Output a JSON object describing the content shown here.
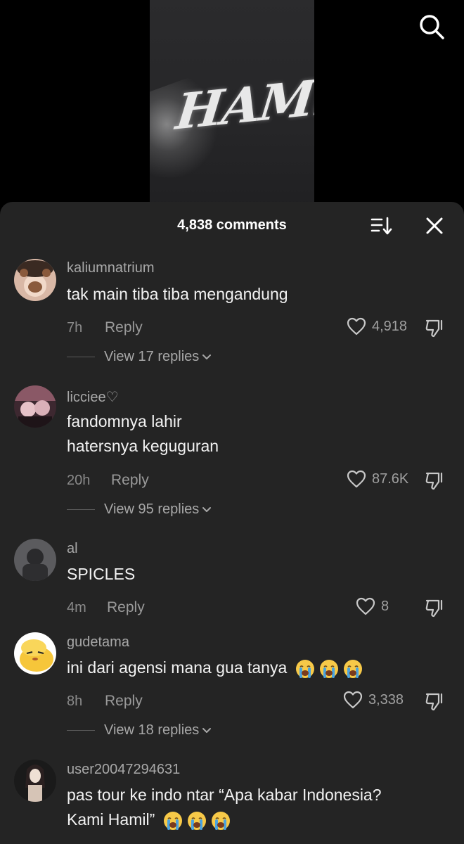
{
  "video": {
    "title_art": "HAMiL"
  },
  "header": {
    "comment_count": "4,838 comments"
  },
  "comments": [
    {
      "username": "kaliumnatrium",
      "lines": [
        "tak main tiba tiba mengandung"
      ],
      "time": "7h",
      "reply_label": "Reply",
      "likes": "4,918",
      "view_replies": "View 17 replies"
    },
    {
      "username": "licciee♡",
      "lines": [
        "fandomnya lahir",
        "hatersnya keguguran"
      ],
      "time": "20h",
      "reply_label": "Reply",
      "likes": "87.6K",
      "view_replies": "View 95 replies"
    },
    {
      "username": "al",
      "lines": [
        "SPICLES"
      ],
      "time": "4m",
      "reply_label": "Reply",
      "likes": "8"
    },
    {
      "username": "gudetama",
      "lines": [
        "ini dari agensi mana gua tanya"
      ],
      "time": "8h",
      "reply_label": "Reply",
      "likes": "3,338",
      "view_replies": "View 18 replies"
    },
    {
      "username": "user20047294631",
      "lines": [
        "pas tour ke indo ntar “Apa kabar Indonesia?",
        "Kami Hamil”"
      ]
    }
  ],
  "icons": {
    "search": "search-icon",
    "sort": "sort-icon",
    "close": "close-icon",
    "like": "heart-icon",
    "dislike": "thumbs-down-icon",
    "emoji": "loudly-crying-face"
  },
  "colors": {
    "sheet_bg": "#242424",
    "muted_text": "#8a8a8a",
    "emoji_yellow": "#f7c948",
    "tears_blue": "#4aa3df"
  }
}
